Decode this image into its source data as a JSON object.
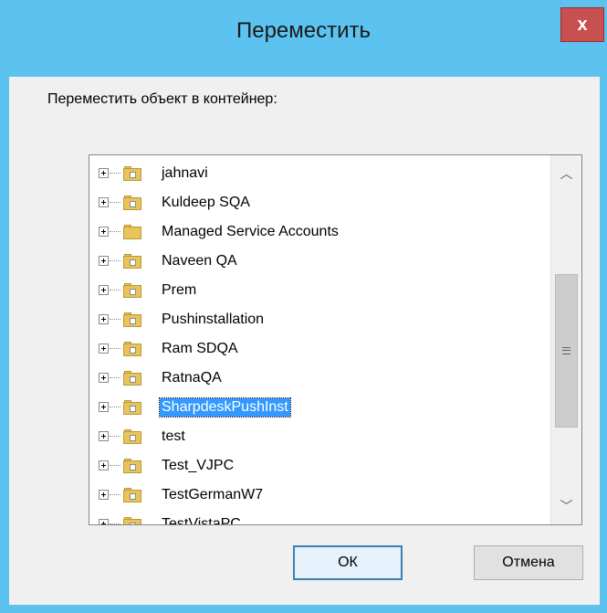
{
  "window": {
    "title": "Переместить",
    "close_glyph": "x"
  },
  "prompt": "Переместить объект в контейнер:",
  "tree": {
    "items": [
      {
        "label": "jahnavi",
        "icon": "folder-ou-icon"
      },
      {
        "label": "Kuldeep SQA",
        "icon": "folder-ou-icon"
      },
      {
        "label": "Managed Service Accounts",
        "icon": "folder-icon"
      },
      {
        "label": "Naveen QA",
        "icon": "folder-ou-icon"
      },
      {
        "label": "Prem",
        "icon": "folder-ou-icon"
      },
      {
        "label": "Pushinstallation",
        "icon": "folder-ou-icon"
      },
      {
        "label": "Ram SDQA",
        "icon": "folder-ou-icon"
      },
      {
        "label": "RatnaQA",
        "icon": "folder-ou-icon"
      },
      {
        "label": "SharpdeskPushInst",
        "icon": "folder-ou-icon",
        "selected": true
      },
      {
        "label": "test",
        "icon": "folder-ou-icon"
      },
      {
        "label": "Test_VJPC",
        "icon": "folder-ou-icon"
      },
      {
        "label": "TestGermanW7",
        "icon": "folder-ou-icon"
      },
      {
        "label": "TestVistaPC",
        "icon": "folder-ou-icon"
      }
    ],
    "scroll_up_glyph": "︿",
    "scroll_down_glyph": "﹀"
  },
  "buttons": {
    "ok": "ОК",
    "cancel": "Отмена"
  },
  "colors": {
    "titlebar": "#5cc3f0",
    "close": "#c75050",
    "selection": "#3399ff"
  }
}
